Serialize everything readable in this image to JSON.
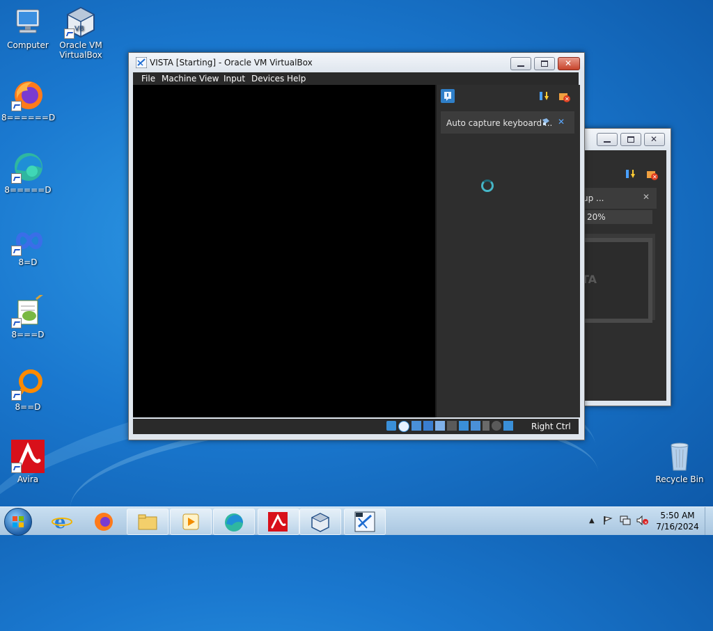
{
  "desktop": {
    "icons": [
      {
        "label": "Computer",
        "icon": "computer-icon"
      },
      {
        "label": "Oracle VM VirtualBox",
        "icon": "virtualbox-icon"
      },
      {
        "label": "8======D",
        "icon": "firefox-icon"
      },
      {
        "label": "8=====D",
        "icon": "edge-icon"
      },
      {
        "label": "8=D",
        "icon": "infinity-icon"
      },
      {
        "label": "8===D",
        "icon": "notepad-plus-icon"
      },
      {
        "label": "8==D",
        "icon": "orange-ring-icon"
      },
      {
        "label": "Avira",
        "icon": "avira-icon"
      },
      {
        "label": "Recycle Bin",
        "icon": "recycle-bin-icon"
      }
    ]
  },
  "vm_window": {
    "title": "VISTA [Starting] - Oracle VM VirtualBox",
    "menu": [
      "File",
      "Machine",
      "View",
      "Input",
      "Devices",
      "Help"
    ],
    "notification": {
      "text": "Auto capture keyboard ..."
    },
    "status_host_key": "Right Ctrl"
  },
  "back_window": {
    "notification_text": "up ...",
    "progress_text": "20%",
    "preview_text": "TA"
  },
  "taskbar": {
    "clock_time": "5:50 AM",
    "clock_date": "7/16/2024"
  },
  "colors": {
    "panel_bg": "#2e2e2e",
    "notification_bg": "#3c3c3c",
    "accent_blue": "#3a8fd8"
  }
}
